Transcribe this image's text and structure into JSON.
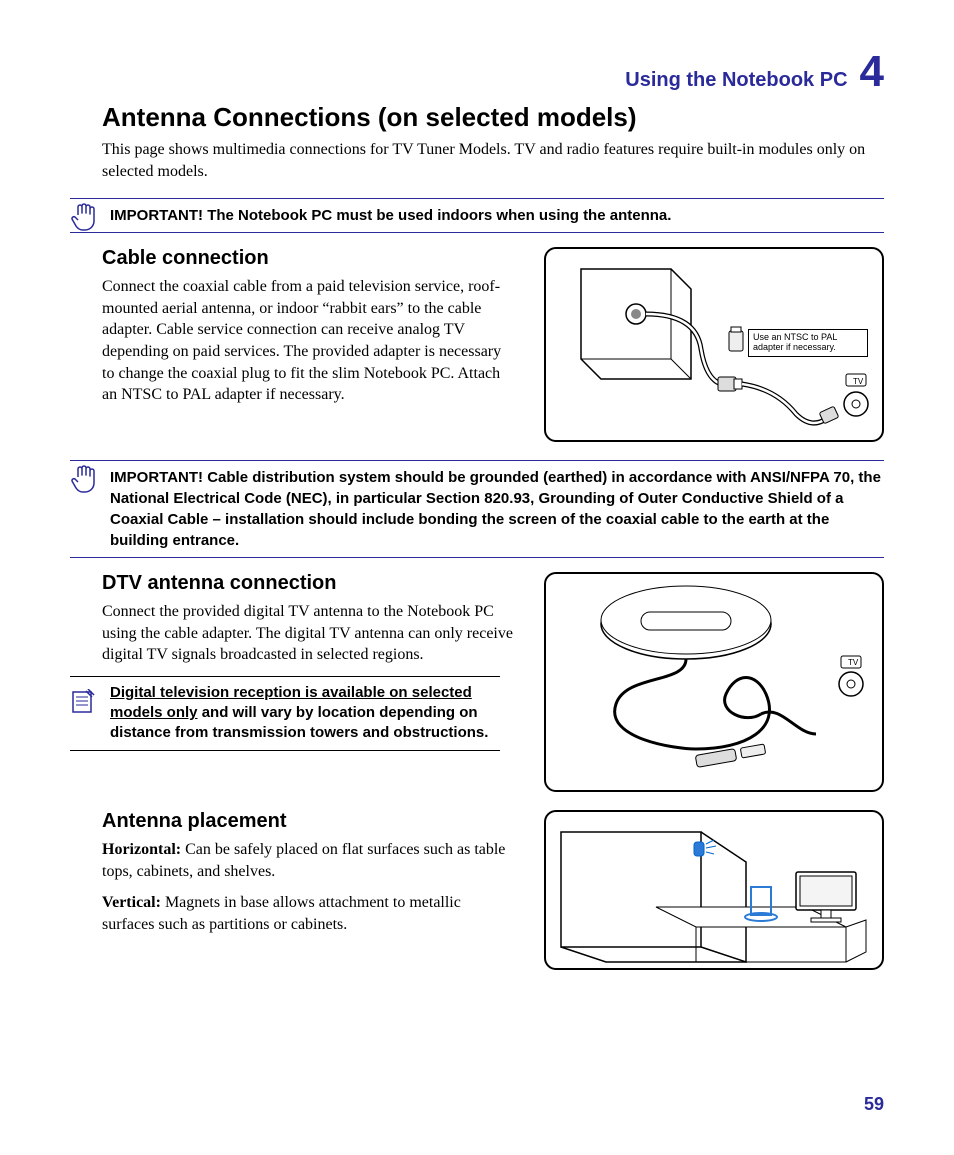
{
  "header": {
    "chapter_title": "Using the Notebook PC",
    "chapter_number": "4"
  },
  "page_title": "Antenna Connections (on selected models)",
  "intro": "This page shows multimedia connections for TV Tuner Models. TV and radio features require built-in modules only on selected models.",
  "important_1": "IMPORTANT! The Notebook PC must be used indoors when using the antenna.",
  "cable": {
    "heading": "Cable connection",
    "body": "Connect the coaxial cable from a paid television service, roof-mounted aerial antenna, or indoor “rabbit ears” to the cable adapter. Cable service connection can receive analog TV depending on paid services. The provided adapter is necessary to change the coaxial plug to fit the slim Notebook PC. Attach an NTSC to PAL adapter if necessary.",
    "fig_label": "Use an NTSC to PAL adapter if necessary."
  },
  "important_2": "IMPORTANT!  Cable distribution system should be grounded (earthed) in accordance with ANSI/NFPA 70, the National Electrical Code (NEC), in particular Section 820.93, Grounding of Outer Conductive Shield of a Coaxial Cable – installation should include bonding the screen of the coaxial cable to the earth at the building entrance.",
  "dtv": {
    "heading": "DTV antenna connection",
    "body": "Connect the provided digital TV antenna to the Notebook PC using the cable adapter. The digital TV antenna can only receive digital TV signals broadcasted in selected regions.",
    "note_u": "Digital television reception is available on selected models only",
    "note_rest": " and will vary by location depending on distance from transmission towers and obstructions."
  },
  "placement": {
    "heading": "Antenna placement",
    "horizontal_label": "Horizontal:",
    "horizontal_body": " Can be safely placed on flat surfaces such as table tops, cabinets, and shelves.",
    "vertical_label": "Vertical:",
    "vertical_body": " Magnets in base allows attachment to metallic surfaces such as partitions or cabinets."
  },
  "page_number": "59"
}
